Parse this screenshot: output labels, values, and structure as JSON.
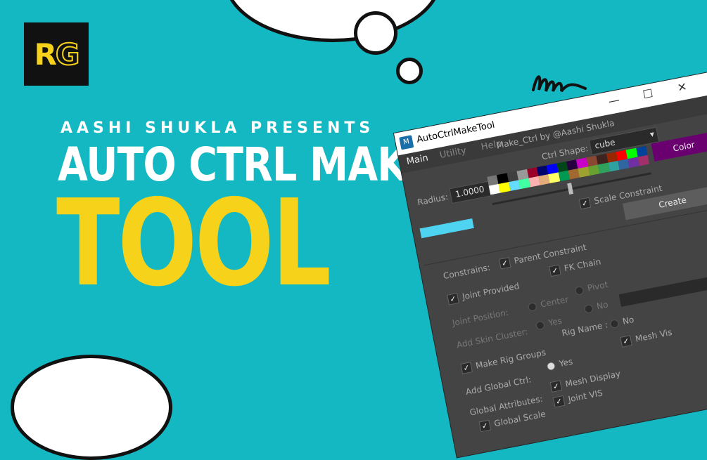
{
  "logo": {
    "r": "R",
    "g": "G"
  },
  "presents": "AASHI SHUKLA PRESENTS",
  "title_line1": "AUTO CTRL MAKE",
  "title_line2": "TOOL",
  "window": {
    "title": "AutoCtrlMakeTool",
    "icon_label": "M",
    "controls": [
      "—",
      "☐",
      "✕"
    ],
    "tabs": [
      "Main",
      "Utility",
      "Help"
    ],
    "credit": "Make_Ctrl by @Aashi Shukla",
    "ctrl_shape_label": "Ctrl Shape:",
    "ctrl_shape_value": "cube",
    "radius_label": "Radius:",
    "radius_value": "1.0000",
    "color_button": "Color",
    "color_swatch": "#6a006f",
    "current_color": "#4ed4f0",
    "palette": [
      "#777777",
      "#000000",
      "#3f3f3f",
      "#999999",
      "#9b0028",
      "#00046b",
      "#0000ff",
      "#004619",
      "#26003f",
      "#c800c8",
      "#8a4833",
      "#3f231f",
      "#992600",
      "#ff0000",
      "#00ff00",
      "#004199",
      "#ffffff",
      "#ffff00",
      "#64dbff",
      "#43ffa3",
      "#ffb0b0",
      "#e4ac79",
      "#ffff63",
      "#009954",
      "#a16930",
      "#9ea130",
      "#68a130",
      "#30a15d",
      "#30a1a1",
      "#3067a1",
      "#6f30a1",
      "#a1306a"
    ],
    "scale_constraint": "Scale Constraint",
    "create_button": "Create",
    "constrains_label": "Constrains:",
    "parent_constraint": "Parent Constraint",
    "fk_chain": "FK Chain",
    "joint_provided": "Joint Provided",
    "joint_position_label": "Joint Position:",
    "center": "Center",
    "pivot": "Pivot",
    "add_skin_cluster_label": "Add Skin Cluster:",
    "yes": "Yes",
    "no": "No",
    "make_rig_groups": "Make Rig Groups",
    "rig_name_label": "Rig Name :",
    "add_global_ctrl_label": "Add Global Ctrl:",
    "mesh_vis": "Mesh Vis",
    "global_attributes_label": "Global Attributes:",
    "mesh_display": "Mesh Display",
    "global_scale": "Global Scale",
    "joint_vis": "Joint VIS",
    "check": "✓"
  }
}
